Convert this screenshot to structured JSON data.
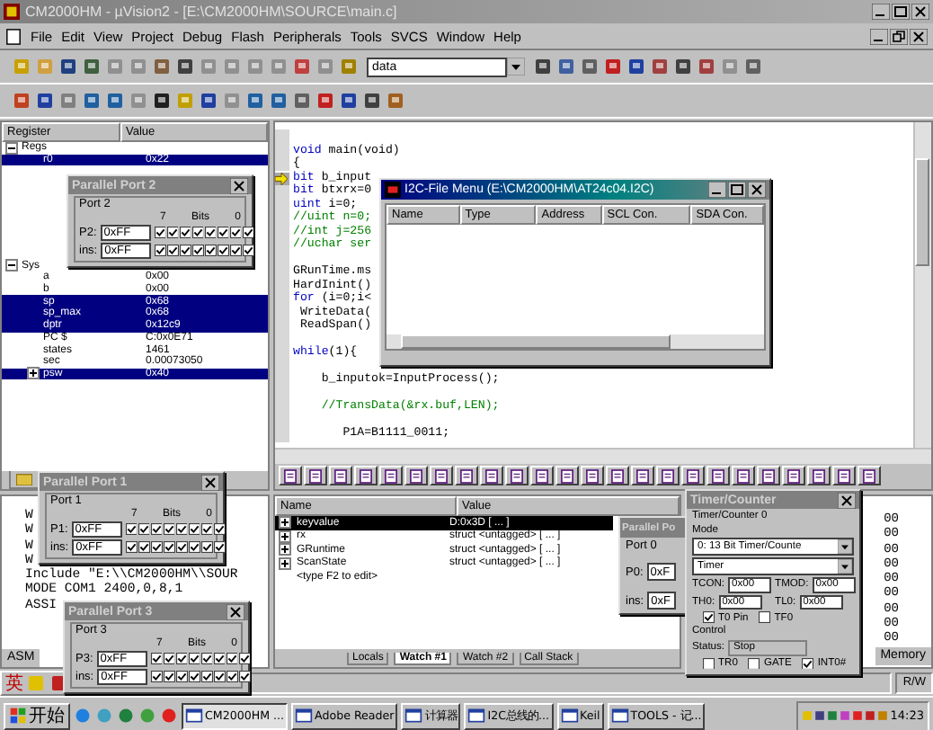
{
  "window": {
    "title": "CM2000HM - µVision2 - [E:\\CM2000HM\\SOURCE\\main.c]"
  },
  "menu": [
    "File",
    "Edit",
    "View",
    "Project",
    "Debug",
    "Flash",
    "Peripherals",
    "Tools",
    "SVCS",
    "Window",
    "Help"
  ],
  "search": {
    "value": "data"
  },
  "registers": {
    "columns": [
      "Register",
      "Value"
    ],
    "groups": [
      {
        "name": "Regs",
        "expanded": true,
        "children": [
          {
            "name": "r0",
            "value": "0x22",
            "selected": true,
            "expandable": false
          }
        ]
      },
      {
        "name": "Sys",
        "expanded": true,
        "children": [
          {
            "name": "a",
            "value": "0x00",
            "selected": false,
            "expandable": false
          },
          {
            "name": "b",
            "value": "0x00",
            "selected": false,
            "expandable": false
          },
          {
            "name": "sp",
            "value": "0x68",
            "selected": true,
            "expandable": false
          },
          {
            "name": "sp_max",
            "value": "0x68",
            "selected": true,
            "expandable": false
          },
          {
            "name": "dptr",
            "value": "0x12c9",
            "selected": true,
            "expandable": false
          },
          {
            "name": "PC  $",
            "value": "C:0x0E71",
            "selected": false,
            "expandable": false
          },
          {
            "name": "states",
            "value": "1461",
            "selected": false,
            "expandable": false
          },
          {
            "name": "sec",
            "value": "0.00073050",
            "selected": false,
            "expandable": false
          },
          {
            "name": "psw",
            "value": "0x40",
            "selected": true,
            "expandable": true
          }
        ]
      }
    ]
  },
  "editor": {
    "lines": [
      {
        "kind": "blank",
        "current": false
      },
      {
        "kind": "code",
        "kw": "void",
        "text": " main(void)",
        "current": false
      },
      {
        "kind": "code",
        "text": "{",
        "current": false
      },
      {
        "kind": "code",
        "kw": "bit",
        "text": " b_input",
        "current": true
      },
      {
        "kind": "code",
        "kw": "bit",
        "text": " btxrx=0",
        "current": false
      },
      {
        "kind": "code",
        "kw": "uint",
        "text": " i=0;",
        "current": false
      },
      {
        "kind": "comment",
        "text": "//uint n=0;",
        "current": false
      },
      {
        "kind": "comment",
        "text": "//int j=256",
        "current": false
      },
      {
        "kind": "comment",
        "text": "//uchar ser",
        "current": false
      },
      {
        "kind": "blank",
        "current": false
      },
      {
        "kind": "code",
        "text": "GRunTime.ms",
        "current": false
      },
      {
        "kind": "code",
        "text": "HardInint()",
        "current": false
      },
      {
        "kind": "code",
        "kw": "for",
        "text": " (i=0;i<",
        "current": false
      },
      {
        "kind": "code",
        "text": " WriteData(",
        "current": false
      },
      {
        "kind": "code",
        "text": " ReadSpan()",
        "current": false
      },
      {
        "kind": "blank",
        "current": false
      },
      {
        "kind": "code",
        "kw": "while",
        "text": "(1){",
        "current": false
      },
      {
        "kind": "blank",
        "current": false
      },
      {
        "kind": "code",
        "text": "    b_inputok=InputProcess();",
        "current": false
      },
      {
        "kind": "blank",
        "current": false
      },
      {
        "kind": "comment",
        "text": "    //TransData(&rx.buf,LEN);",
        "current": false
      },
      {
        "kind": "blank",
        "current": false
      },
      {
        "kind": "code",
        "text": "       P1A=B1111_0011;",
        "current": false
      }
    ]
  },
  "output": {
    "lines": [
      "W",
      "W",
      "W",
      "W",
      "Include \"E:\\\\CM2000HM\\\\SOUR",
      "MODE COM1 2400,0,8,1",
      "ASSI"
    ],
    "tab": "ASM"
  },
  "watch": {
    "columns": [
      "Name",
      "Value"
    ],
    "rows": [
      {
        "name": "keyvalue",
        "value": "D:0x3D [ ... ]",
        "selected": true,
        "expandable": true
      },
      {
        "name": "rx",
        "value": "struct <untagged> [ ... ]",
        "selected": false,
        "expandable": true
      },
      {
        "name": "GRuntime",
        "value": "struct <untagged> [ ... ]",
        "selected": false,
        "expandable": true
      },
      {
        "name": "ScanState",
        "value": "struct <untagged> [ ... ]",
        "selected": false,
        "expandable": true
      },
      {
        "name": "<type F2 to edit>",
        "selected": false,
        "expandable": false
      }
    ],
    "tabs": [
      {
        "label": "Locals",
        "selected": false
      },
      {
        "label": "Watch #1",
        "selected": true
      },
      {
        "label": "Watch #2",
        "selected": false
      },
      {
        "label": "Call Stack",
        "selected": false
      }
    ]
  },
  "memory": {
    "values": [
      "00",
      "00",
      "00",
      "00",
      "00",
      "00",
      "00",
      "00",
      "00"
    ],
    "tab": "Memory"
  },
  "status_bar": {
    "rw": "R/W"
  },
  "ime": {
    "label": "英"
  },
  "taskbar": {
    "start": "开始",
    "tasks": [
      {
        "label": "CM2000HM ...",
        "selected": true
      },
      {
        "label": "Adobe Reader",
        "selected": false
      },
      {
        "label": "计算器",
        "selected": false
      },
      {
        "label": "I2C总线的...",
        "selected": false
      },
      {
        "label": "Keil",
        "selected": false
      },
      {
        "label": "TOOLS - 记...",
        "selected": false
      }
    ],
    "clock": "14:23"
  },
  "file_menu": {
    "title": "I2C-File Menu (E:\\CM2000HM\\AT24c04.I2C)",
    "columns": [
      "Name",
      "Type",
      "Address",
      "SCL Con.",
      "SDA Con."
    ]
  },
  "parallel_ports": [
    {
      "title": "Parallel Port 2",
      "group": "Port 2",
      "port_label": "P2:",
      "port_value": "0xFF",
      "pins_label": "ins:",
      "pins_value": "0xFF",
      "hi": "7",
      "bits_label": "Bits",
      "lo": "0",
      "bits": [
        true,
        true,
        true,
        true,
        true,
        true,
        true,
        true
      ],
      "pins": [
        true,
        true,
        true,
        true,
        true,
        true,
        true,
        true
      ]
    },
    {
      "title": "Parallel Port 1",
      "group": "Port 1",
      "port_label": "P1:",
      "port_value": "0xFF",
      "pins_label": "ins:",
      "pins_value": "0xFF",
      "hi": "7",
      "bits_label": "Bits",
      "lo": "0",
      "bits": [
        true,
        true,
        true,
        true,
        true,
        true,
        true,
        true
      ],
      "pins": [
        true,
        true,
        true,
        true,
        true,
        true,
        true,
        true
      ]
    },
    {
      "title": "Parallel Port 3",
      "group": "Port 3",
      "port_label": "P3:",
      "port_value": "0xFF",
      "pins_label": "ins:",
      "pins_value": "0xFF",
      "hi": "7",
      "bits_label": "Bits",
      "lo": "0",
      "bits": [
        true,
        true,
        true,
        true,
        true,
        true,
        true,
        true
      ],
      "pins": [
        true,
        true,
        true,
        true,
        true,
        true,
        true,
        true
      ]
    }
  ],
  "parallel_port_0": {
    "title": "Parallel Po",
    "group": "Port 0",
    "port_label": "P0:",
    "port_value": "0xF",
    "pins_label": "ins:",
    "pins_value": "0xF"
  },
  "timer": {
    "title": "Timer/Counter",
    "group": "Timer/Counter 0",
    "mode_label": "Mode",
    "mode": "0: 13 Bit Timer/Counte",
    "source": "Timer",
    "regs": [
      {
        "label": "TCON:",
        "value": "0x00"
      },
      {
        "label": "TMOD:",
        "value": "0x00"
      },
      {
        "label": "TH0:",
        "value": "0x00"
      },
      {
        "label": "TL0:",
        "value": "0x00"
      }
    ],
    "flags": [
      {
        "label": "T0 Pin",
        "checked": true
      },
      {
        "label": "TF0",
        "checked": false
      }
    ],
    "control_label": "Control",
    "status_label": "Status:",
    "status": "Stop",
    "controls": [
      {
        "label": "TR0",
        "checked": false
      },
      {
        "label": "GATE",
        "checked": false
      },
      {
        "label": "INT0#",
        "checked": true
      }
    ]
  }
}
